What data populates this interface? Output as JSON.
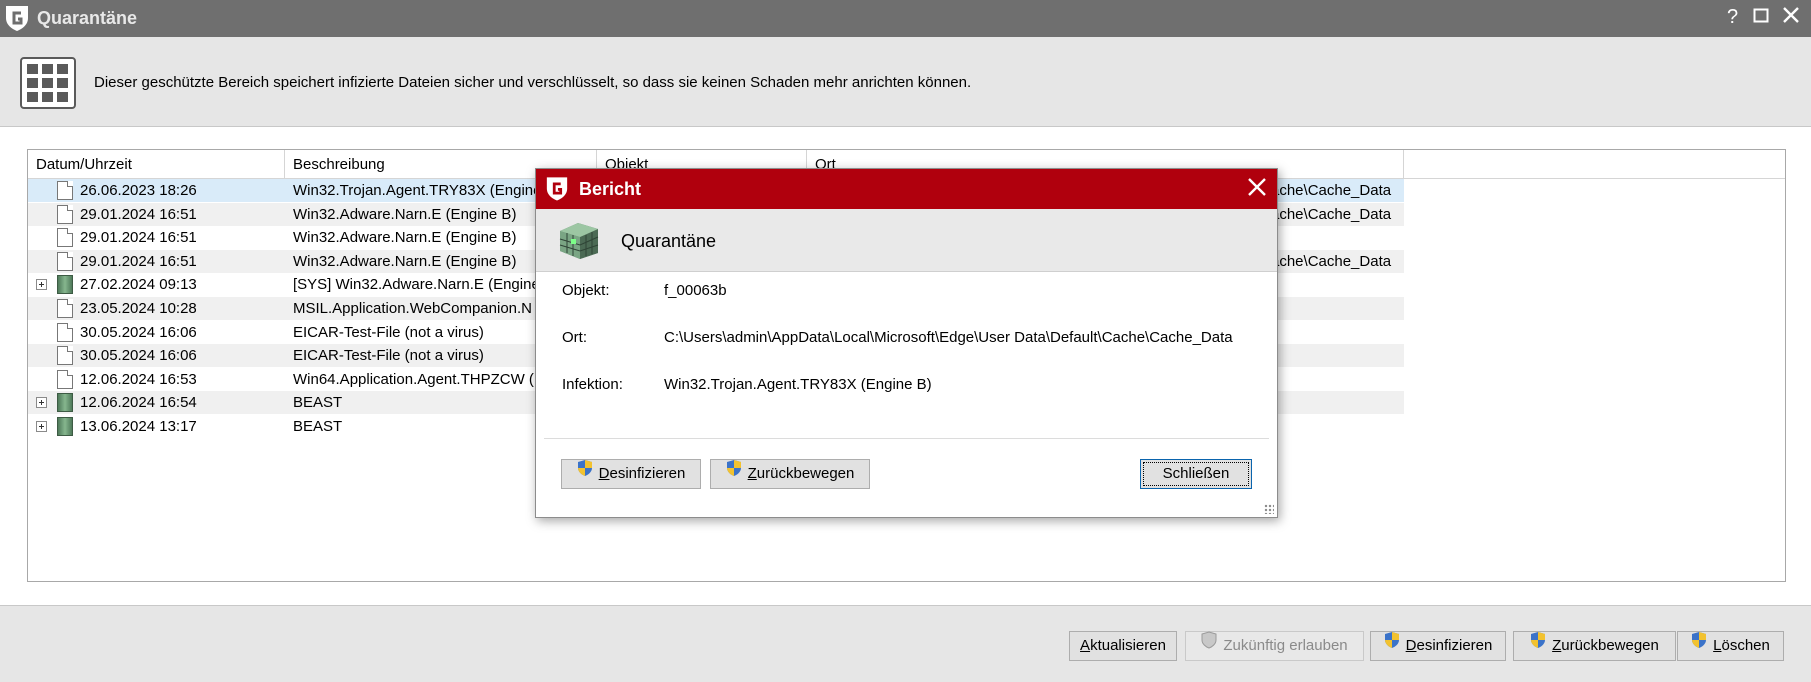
{
  "window": {
    "title": "Quarantäne",
    "help_icon": "?",
    "maximize_icon": "□",
    "close_icon": "✕"
  },
  "info": {
    "description": "Dieser geschützte Bereich speichert infizierte Dateien sicher und verschlüsselt, so dass sie keinen Schaden mehr anrichten können."
  },
  "table": {
    "columns": [
      "Datum/Uhrzeit",
      "Beschreibung",
      "Objekt",
      "Ort"
    ],
    "rows": [
      {
        "date": "26.06.2023 18:26",
        "desc": "Win32.Trojan.Agent.TRY83X (Engine B)",
        "ort": "ache\\Cache_Data",
        "icon": "file-icon",
        "expandable": false
      },
      {
        "date": "29.01.2024 16:51",
        "desc": "Win32.Adware.Narn.E (Engine B)",
        "ort": "ache\\Cache_Data",
        "icon": "file-icon",
        "expandable": false
      },
      {
        "date": "29.01.2024 16:51",
        "desc": "Win32.Adware.Narn.E (Engine B)",
        "ort": "",
        "icon": "file-icon",
        "expandable": false
      },
      {
        "date": "29.01.2024 16:51",
        "desc": "Win32.Adware.Narn.E (Engine B)",
        "ort": "ache\\Cache_Data",
        "icon": "file-icon",
        "expandable": false
      },
      {
        "date": "27.02.2024 09:13",
        "desc": "[SYS] Win32.Adware.Narn.E (Engine B)",
        "ort": "",
        "icon": "group-icon",
        "expandable": true
      },
      {
        "date": "23.05.2024 10:28",
        "desc": "MSIL.Application.WebCompanion.N",
        "ort": "",
        "icon": "file-icon",
        "expandable": false
      },
      {
        "date": "30.05.2024 16:06",
        "desc": "EICAR-Test-File (not a virus)",
        "ort": "",
        "icon": "file-icon",
        "expandable": false
      },
      {
        "date": "30.05.2024 16:06",
        "desc": "EICAR-Test-File (not a virus)",
        "ort": "",
        "icon": "file-icon",
        "expandable": false
      },
      {
        "date": "12.06.2024 16:53",
        "desc": "Win64.Application.Agent.THPZCW (E",
        "ort": "",
        "icon": "file-icon",
        "expandable": false
      },
      {
        "date": "12.06.2024 16:54",
        "desc": "BEAST",
        "ort": "",
        "icon": "group-icon",
        "expandable": true
      },
      {
        "date": "13.06.2024 13:17",
        "desc": "BEAST",
        "ort": "",
        "icon": "group-icon",
        "expandable": true
      }
    ]
  },
  "dialog": {
    "title": "Bericht",
    "header": "Quarantäne",
    "objekt_label": "Objekt:",
    "objekt_value": "f_00063b",
    "ort_label": "Ort:",
    "ort_value": "C:\\Users\\admin\\AppData\\Local\\Microsoft\\Edge\\User Data\\Default\\Cache\\Cache_Data",
    "infektion_label": "Infektion:",
    "infektion_value": "Win32.Trojan.Agent.TRY83X (Engine B)",
    "desinfizieren": {
      "key": "D",
      "rest": "esinfizieren"
    },
    "zurueck": {
      "key": "Z",
      "rest": "urückbewegen"
    },
    "schliessen": "Schließen"
  },
  "bottom": {
    "aktualisieren": {
      "key": "A",
      "rest": "ktualisieren"
    },
    "zukuenftig": "Zukünftig erlauben",
    "desinfizieren": {
      "key": "D",
      "rest": "esinfizieren"
    },
    "zurueck": {
      "key": "Z",
      "rest": "urückbewegen"
    },
    "loeschen": {
      "key": "L",
      "rest": "öschen"
    }
  },
  "colors": {
    "titlebar": "#6f6f6f",
    "dialog_title": "#b0000d",
    "selected_row": "#d9ebf9",
    "alt_row": "#f0f0f0"
  }
}
